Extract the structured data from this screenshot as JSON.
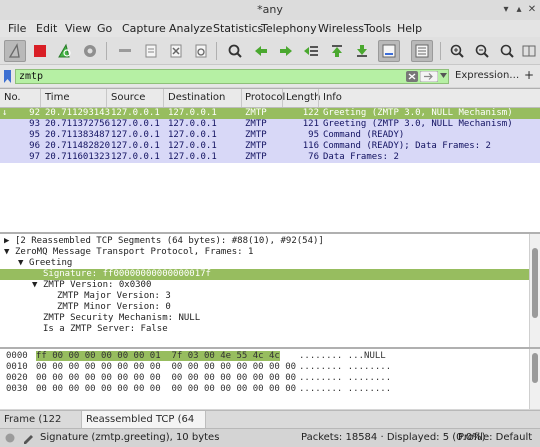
{
  "window": {
    "title": "*any"
  },
  "menu": [
    "File",
    "Edit",
    "View",
    "Go",
    "Capture",
    "Analyze",
    "Statistics",
    "Telephony",
    "Wireless",
    "Tools",
    "Help"
  ],
  "filter": {
    "value": "zmtp",
    "expression_label": "Expression…",
    "plus": "+"
  },
  "columns": [
    "No.",
    "Time",
    "Source",
    "Destination",
    "Protocol",
    "Length",
    "Info"
  ],
  "packets": [
    {
      "no": "92",
      "time": "20.711293143",
      "src": "127.0.0.1",
      "dst": "127.0.0.1",
      "proto": "ZMTP",
      "len": "122",
      "info": "Greeting (ZMTP 3.0, NULL Mechanism)",
      "selected": true
    },
    {
      "no": "93",
      "time": "20.711372756",
      "src": "127.0.0.1",
      "dst": "127.0.0.1",
      "proto": "ZMTP",
      "len": "121",
      "info": "Greeting (ZMTP 3.0, NULL Mechanism)"
    },
    {
      "no": "95",
      "time": "20.711383487",
      "src": "127.0.0.1",
      "dst": "127.0.0.1",
      "proto": "ZMTP",
      "len": "95",
      "info": "Command (READY)"
    },
    {
      "no": "96",
      "time": "20.711482820",
      "src": "127.0.0.1",
      "dst": "127.0.0.1",
      "proto": "ZMTP",
      "len": "116",
      "info": "Command (READY); Data Frames: 2"
    },
    {
      "no": "97",
      "time": "20.711601323",
      "src": "127.0.0.1",
      "dst": "127.0.0.1",
      "proto": "ZMTP",
      "len": "76",
      "info": "Data Frames: 2"
    }
  ],
  "details": [
    {
      "indent": 0,
      "tri": "▶",
      "text": "[2 Reassembled TCP Segments (64 bytes): #88(10), #92(54)]"
    },
    {
      "indent": 0,
      "tri": "▼",
      "text": "ZeroMQ Message Transport Protocol, Frames: 1"
    },
    {
      "indent": 1,
      "tri": "▼",
      "text": "Greeting"
    },
    {
      "indent": 2,
      "tri": "",
      "text": "Signature: ff00000000000000017f",
      "hl": true
    },
    {
      "indent": 2,
      "tri": "▼",
      "text": "ZMTP Version: 0x0300"
    },
    {
      "indent": 3,
      "tri": "",
      "text": "ZMTP Major Version: 3"
    },
    {
      "indent": 3,
      "tri": "",
      "text": "ZMTP Minor Version: 0"
    },
    {
      "indent": 2,
      "tri": "",
      "text": "ZMTP Security Mechanism: NULL"
    },
    {
      "indent": 2,
      "tri": "",
      "text": "Is a ZMTP Server: False"
    }
  ],
  "hex": [
    {
      "offset": "0000",
      "bytes": "ff 00 00 00 00 00 00 01  7f 03 00 4e 55 4c 4c",
      "ascii": "........ ...NULL"
    },
    {
      "offset": "0010",
      "bytes": "00 00 00 00 00 00 00 00  00 00 00 00 00 00 00 00",
      "ascii": "........ ........"
    },
    {
      "offset": "0020",
      "bytes": "00 00 00 00 00 00 00 00  00 00 00 00 00 00 00 00",
      "ascii": "........ ........"
    },
    {
      "offset": "0030",
      "bytes": "00 00 00 00 00 00 00 00  00 00 00 00 00 00 00 00",
      "ascii": "........ ........"
    }
  ],
  "tabs": [
    "Frame (122 bytes)",
    "Reassembled TCP (64 bytes)"
  ],
  "status": {
    "field": "Signature (zmtp.greeting), 10 bytes",
    "packets": "Packets: 18584 · Displayed: 5 (0.0%)",
    "profile": "Profile: Default"
  },
  "colors": {
    "selected": "#97bd5f",
    "zmtp_row": "#d8d8f7",
    "filter_ok": "#b6f0a4"
  }
}
